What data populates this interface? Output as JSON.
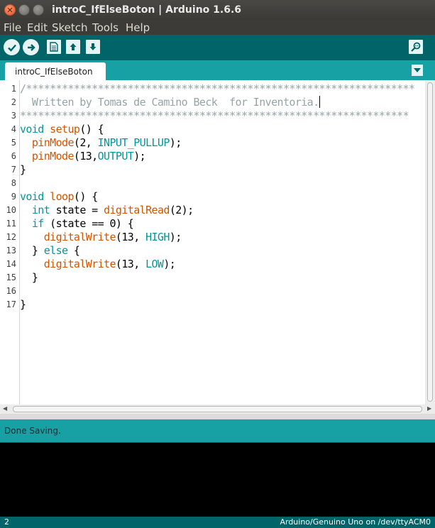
{
  "window": {
    "title": "introC_IfElseBoton | Arduino 1.6.6",
    "close_glyph": "✕"
  },
  "menu": {
    "items": [
      {
        "label": "File"
      },
      {
        "label": "Edit"
      },
      {
        "label": "Sketch"
      },
      {
        "label": "Tools"
      },
      {
        "label": "Help"
      }
    ]
  },
  "toolbar": {
    "icons": [
      "verify-icon",
      "upload-icon",
      "new-icon",
      "open-icon",
      "save-icon",
      "serial-monitor-icon"
    ]
  },
  "tab": {
    "label": "introC_IfElseBoton"
  },
  "editor": {
    "line_numbers": [
      "1",
      "2",
      "3",
      "4",
      "5",
      "6",
      "7",
      "8",
      "9",
      "10",
      "11",
      "12",
      "13",
      "14",
      "15",
      "16",
      "17"
    ],
    "lines": [
      [
        {
          "t": "/*****************************************************************",
          "c": "comment"
        }
      ],
      [
        {
          "t": "  Written by Tomas de Camino Beck  for Inventoria.",
          "c": "comment"
        }
      ],
      [
        {
          "t": "*****************************************************************",
          "c": "comment"
        }
      ],
      [
        {
          "t": "void",
          "c": "type"
        },
        {
          "t": " ",
          "c": "plain"
        },
        {
          "t": "setup",
          "c": "func"
        },
        {
          "t": "() {",
          "c": "plain"
        }
      ],
      [
        {
          "t": "  ",
          "c": "plain"
        },
        {
          "t": "pinMode",
          "c": "func"
        },
        {
          "t": "(2, ",
          "c": "plain"
        },
        {
          "t": "INPUT_PULLUP",
          "c": "const"
        },
        {
          "t": ");",
          "c": "plain"
        }
      ],
      [
        {
          "t": "  ",
          "c": "plain"
        },
        {
          "t": "pinMode",
          "c": "func"
        },
        {
          "t": "(13,",
          "c": "plain"
        },
        {
          "t": "OUTPUT",
          "c": "const"
        },
        {
          "t": ");",
          "c": "plain"
        }
      ],
      [
        {
          "t": "}",
          "c": "plain"
        }
      ],
      [],
      [
        {
          "t": "void",
          "c": "type"
        },
        {
          "t": " ",
          "c": "plain"
        },
        {
          "t": "loop",
          "c": "func"
        },
        {
          "t": "() {",
          "c": "plain"
        }
      ],
      [
        {
          "t": "  ",
          "c": "plain"
        },
        {
          "t": "int",
          "c": "type"
        },
        {
          "t": " state = ",
          "c": "plain"
        },
        {
          "t": "digitalRead",
          "c": "func"
        },
        {
          "t": "(2);",
          "c": "plain"
        }
      ],
      [
        {
          "t": "  ",
          "c": "plain"
        },
        {
          "t": "if",
          "c": "type"
        },
        {
          "t": " (state == 0) {",
          "c": "plain"
        }
      ],
      [
        {
          "t": "    ",
          "c": "plain"
        },
        {
          "t": "digitalWrite",
          "c": "func"
        },
        {
          "t": "(13, ",
          "c": "plain"
        },
        {
          "t": "HIGH",
          "c": "const"
        },
        {
          "t": ");",
          "c": "plain"
        }
      ],
      [
        {
          "t": "  } ",
          "c": "plain"
        },
        {
          "t": "else",
          "c": "type"
        },
        {
          "t": " {",
          "c": "plain"
        }
      ],
      [
        {
          "t": "    ",
          "c": "plain"
        },
        {
          "t": "digitalWrite",
          "c": "func"
        },
        {
          "t": "(13, ",
          "c": "plain"
        },
        {
          "t": "LOW",
          "c": "const"
        },
        {
          "t": ");",
          "c": "plain"
        }
      ],
      [
        {
          "t": "  }",
          "c": "plain"
        }
      ],
      [],
      [
        {
          "t": "}",
          "c": "plain"
        }
      ]
    ],
    "caret_line": 2
  },
  "status": {
    "message": "Done Saving."
  },
  "footer": {
    "line": "2",
    "board": "Arduino/Genuino Uno on /dev/ttyACM0"
  },
  "colors": {
    "accent_dark": "#006468",
    "accent": "#17a1a5",
    "comment": "#95a5a6",
    "keyword": "#00979c",
    "function": "#d35400"
  }
}
